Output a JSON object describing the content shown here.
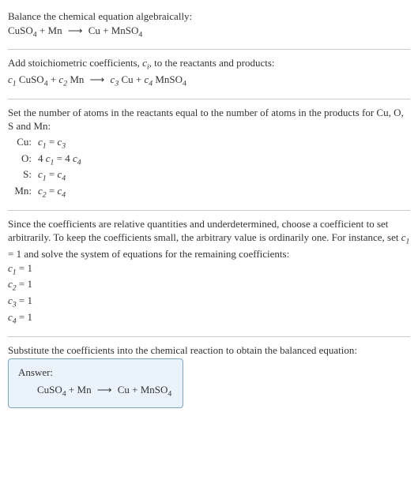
{
  "intro": {
    "line1": "Balance the chemical equation algebraically:"
  },
  "eq_plain": {
    "r1": "CuSO",
    "r1s": "4",
    "r2": "Mn",
    "arrow": "⟶",
    "p1": "Cu",
    "p2": "MnSO",
    "p2s": "4"
  },
  "step_add": {
    "text_a": "Add stoichiometric coefficients, ",
    "ci": "c",
    "ci_sub": "i",
    "text_b": ", to the reactants and products:"
  },
  "eq_coeff": {
    "c1": "c",
    "c1s": "1",
    "r1": "CuSO",
    "r1s": "4",
    "c2": "c",
    "c2s": "2",
    "r2": "Mn",
    "arrow": "⟶",
    "c3": "c",
    "c3s": "3",
    "p1": "Cu",
    "c4": "c",
    "c4s": "4",
    "p2": "MnSO",
    "p2s": "4"
  },
  "step_set": {
    "text": "Set the number of atoms in the reactants equal to the number of atoms in the products for Cu, O, S and Mn:"
  },
  "atoms": {
    "cu": {
      "lbl": "Cu:",
      "lhs_c": "c",
      "lhs_s": "1",
      "eq": " = ",
      "rhs_c": "c",
      "rhs_s": "3"
    },
    "o": {
      "lbl": "O:",
      "lhs_k": "4 ",
      "lhs_c": "c",
      "lhs_s": "1",
      "eq": " = ",
      "rhs_k": "4 ",
      "rhs_c": "c",
      "rhs_s": "4"
    },
    "s": {
      "lbl": "S:",
      "lhs_c": "c",
      "lhs_s": "1",
      "eq": " = ",
      "rhs_c": "c",
      "rhs_s": "4"
    },
    "mn": {
      "lbl": "Mn:",
      "lhs_c": "c",
      "lhs_s": "2",
      "eq": " = ",
      "rhs_c": "c",
      "rhs_s": "4"
    }
  },
  "step_since": {
    "text_a": "Since the coefficients are relative quantities and underdetermined, choose a coefficient to set arbitrarily. To keep the coefficients small, the arbitrary value is ordinarily one. For instance, set ",
    "ci": "c",
    "ci_sub": "1",
    "text_b": " = 1 and solve the system of equations for the remaining coefficients:"
  },
  "solved": {
    "c1": {
      "c": "c",
      "s": "1",
      "v": " = 1"
    },
    "c2": {
      "c": "c",
      "s": "2",
      "v": " = 1"
    },
    "c3": {
      "c": "c",
      "s": "3",
      "v": " = 1"
    },
    "c4": {
      "c": "c",
      "s": "4",
      "v": " = 1"
    }
  },
  "step_sub": {
    "text": "Substitute the coefficients into the chemical reaction to obtain the balanced equation:"
  },
  "answer": {
    "label": "Answer:"
  }
}
